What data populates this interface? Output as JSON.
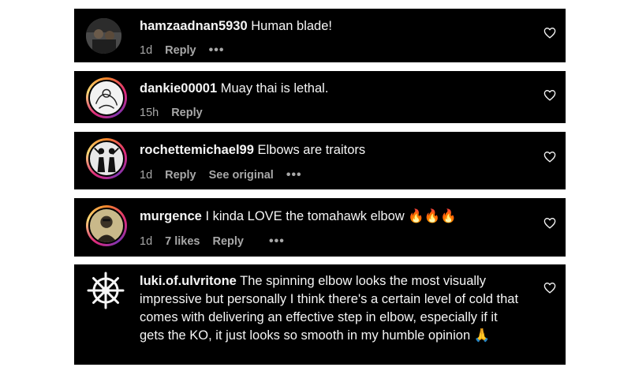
{
  "comments": [
    {
      "username": "hamzaadnan5930",
      "text": "Human blade!",
      "time": "1d",
      "reply_label": "Reply",
      "more_label": "•••"
    },
    {
      "username": "dankie00001",
      "text": "Muay thai is lethal.",
      "time": "15h",
      "reply_label": "Reply"
    },
    {
      "username": "rochettemichael99",
      "text": "Elbows are traitors",
      "time": "1d",
      "reply_label": "Reply",
      "see_original_label": "See original",
      "more_label": "•••"
    },
    {
      "username": "murgence",
      "text": "I kinda LOVE the tomahawk elbow 🔥🔥🔥",
      "time": "1d",
      "likes_label": "7 likes",
      "reply_label": "Reply",
      "more_label": "•••"
    },
    {
      "username": "luki.of.ulvritone",
      "text": "The spinning elbow looks the most visually impressive but personally I think there's a certain level of cold that comes with delivering an effective step in elbow, especially if it gets the KO, it just looks so smooth in my humble opinion 🙏"
    }
  ],
  "icons": {
    "heart": "heart-outline-icon",
    "more": "more-dots-icon"
  },
  "colors": {
    "card_background": "#000000",
    "text": "#f5f5f5",
    "meta_text": "#a8a8a8",
    "story_ring": "#dd2a7b"
  }
}
